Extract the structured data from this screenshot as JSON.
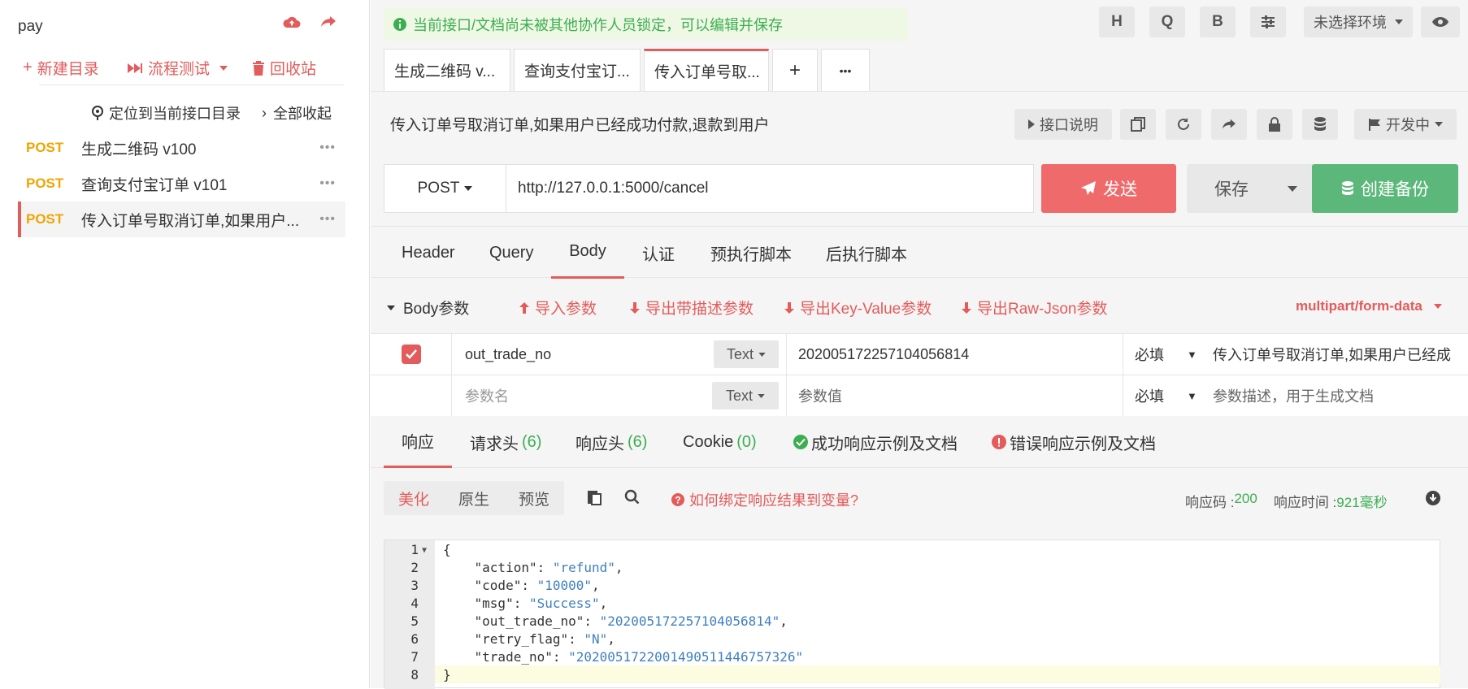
{
  "sidebar": {
    "project": "pay",
    "actions": {
      "new_dir": "新建目录",
      "flow_test": "流程测试",
      "recycle": "回收站"
    },
    "locate": "定位到当前接口目录",
    "collapse": "全部收起",
    "items": [
      {
        "method": "POST",
        "name": "生成二维码 v100",
        "more": "•••"
      },
      {
        "method": "POST",
        "name": "查询支付宝订单 v101",
        "more": "•••"
      },
      {
        "method": "POST",
        "name": "传入订单号取消订单,如果用户...",
        "more": "•••"
      }
    ]
  },
  "notice": "当前接口/文档尚未被其他协作人员锁定，可以编辑并保存",
  "topbar": {
    "h": "H",
    "q": "Q",
    "b": "B",
    "env": "未选择环境"
  },
  "tabs": [
    {
      "label": "生成二维码 v..."
    },
    {
      "label": "查询支付宝订..."
    },
    {
      "label": "传入订单号取..."
    }
  ],
  "tab_add": "+",
  "tab_more": "•••",
  "api": {
    "title": "传入订单号取消订单,如果用户已经成功付款,退款到用户",
    "doc_label": "接口说明",
    "status": "开发中"
  },
  "request": {
    "method": "POST",
    "url": "http://127.0.0.1:5000/cancel",
    "send": "发送",
    "save": "保存",
    "backup": "创建备份"
  },
  "param_tabs": [
    "Header",
    "Query",
    "Body",
    "认证",
    "预执行脚本",
    "后执行脚本"
  ],
  "body_bar": {
    "label": "Body参数",
    "import": "导入参数",
    "export_desc": "导出带描述参数",
    "export_kv": "导出Key-Value参数",
    "export_json": "导出Raw-Json参数",
    "content_type": "multipart/form-data"
  },
  "params": [
    {
      "name": "out_trade_no",
      "type": "Text",
      "value": "20200517225710405681​4",
      "required": "必填",
      "desc": "传入订单号取消订单,如果用户已经成"
    },
    {
      "name_placeholder": "参数名",
      "type": "Text",
      "value_placeholder": "参数值",
      "required": "必填",
      "desc_placeholder": "参数描述，用于生成文档"
    }
  ],
  "resp_tabs": {
    "response": "响应",
    "req_headers": "请求头",
    "req_headers_count": "(6)",
    "resp_headers": "响应头",
    "resp_headers_count": "(6)",
    "cookie": "Cookie",
    "cookie_count": "(0)",
    "success_doc": "成功响应示例及文档",
    "error_doc": "错误响应示例及文档"
  },
  "resp_tools": {
    "pretty": "美化",
    "raw": "原生",
    "preview": "预览",
    "bind_help": "如何绑定响应结果到变量?"
  },
  "resp_meta": {
    "code_label": "响应码 : ",
    "code": "200",
    "time_label": "响应时间 : ",
    "time": "921毫秒"
  },
  "code_lines": [
    {
      "n": "1",
      "t": "{"
    },
    {
      "n": "2",
      "k": "    \"action\": ",
      "v": "\"refund\"",
      "e": ","
    },
    {
      "n": "3",
      "k": "    \"code\": ",
      "v": "\"10000\"",
      "e": ","
    },
    {
      "n": "4",
      "k": "    \"msg\": ",
      "v": "\"Success\"",
      "e": ","
    },
    {
      "n": "5",
      "k": "    \"out_trade_no\": ",
      "v": "\"202005172257104056814\"",
      "e": ","
    },
    {
      "n": "6",
      "k": "    \"retry_flag\": ",
      "v": "\"N\"",
      "e": ","
    },
    {
      "n": "7",
      "k": "    \"trade_no\": ",
      "v": "\"2020051722001490511446757326\"",
      "e": ""
    },
    {
      "n": "8",
      "t": "}"
    }
  ],
  "colors": {
    "accent": "#e35b5b",
    "success": "#3cae51",
    "method": "#f0a500",
    "string": "#3f7fbf"
  }
}
